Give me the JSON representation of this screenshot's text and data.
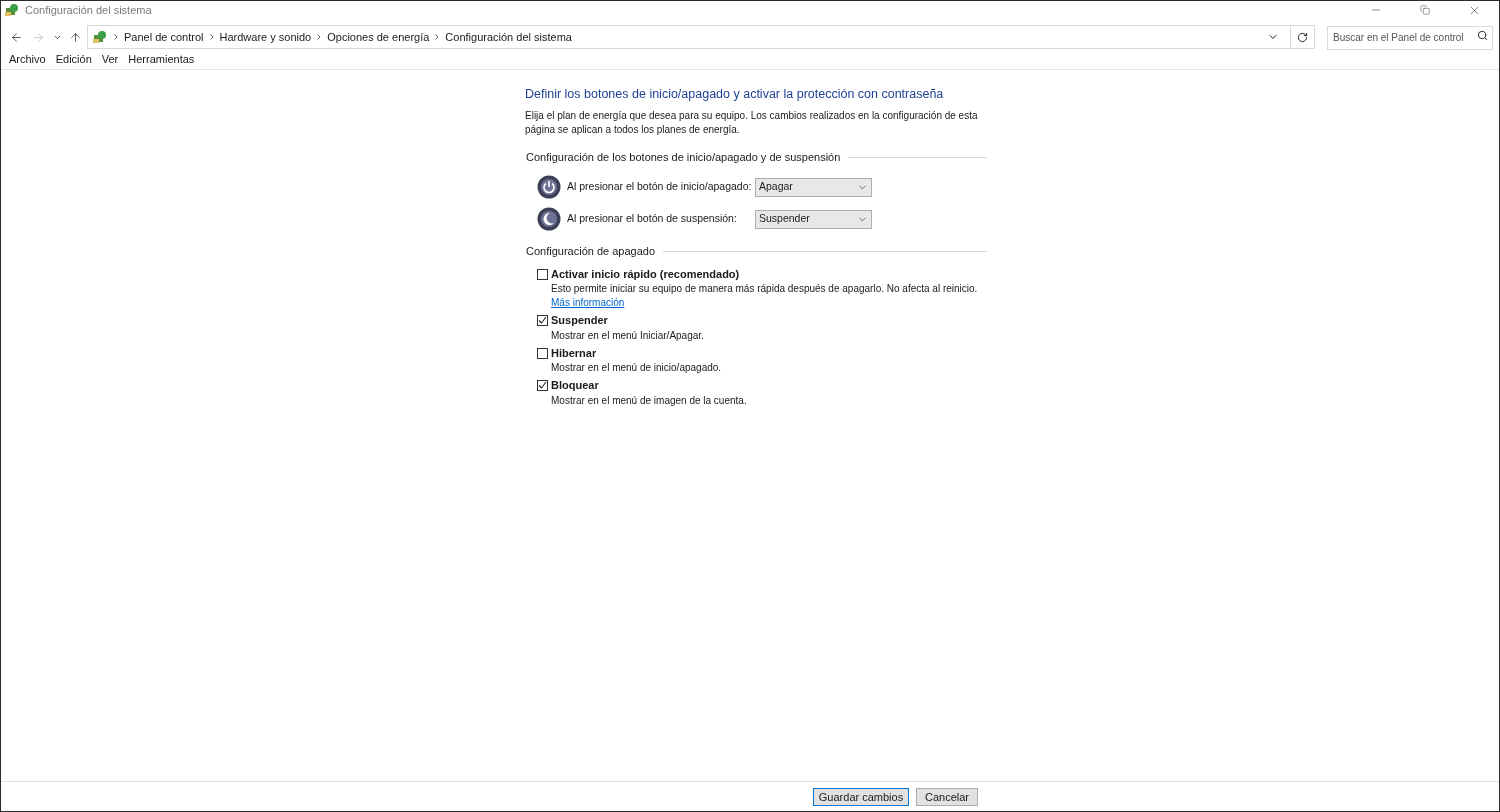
{
  "window": {
    "title": "Configuración del sistema"
  },
  "address_bar": {
    "breadcrumbs": [
      "Panel de control",
      "Hardware y sonido",
      "Opciones de energía",
      "Configuración del sistema"
    ]
  },
  "search": {
    "placeholder": "Buscar en el Panel de control"
  },
  "menu": [
    "Archivo",
    "Edición",
    "Ver",
    "Herramientas"
  ],
  "page": {
    "heading": "Definir los botones de inicio/apagado y activar la protección con contraseña",
    "intro": "Elija el plan de energía que desea para su equipo. Los cambios realizados en la configuración de esta página se aplican a todos los planes de energía.",
    "button_section": {
      "title": "Configuración de los botones de inicio/apagado y de suspensión",
      "rows": [
        {
          "kind": "power",
          "label": "Al presionar el botón de inicio/apagado:",
          "value": "Apagar"
        },
        {
          "kind": "sleep",
          "label": "Al presionar el botón de suspensión:",
          "value": "Suspender"
        }
      ]
    },
    "shutdown_section": {
      "title": "Configuración de apagado",
      "options": [
        {
          "label": "Activar inicio rápido (recomendado)",
          "checked": false,
          "description": "Esto permite iniciar su equipo de manera más rápida después de apagarlo. No afecta al reinicio.",
          "link": "Más información"
        },
        {
          "label": "Suspender",
          "checked": true,
          "description": "Mostrar en el menú Iniciar/Apagar."
        },
        {
          "label": "Hibernar",
          "checked": false,
          "description": "Mostrar en el menú de inicio/apagado."
        },
        {
          "label": "Bloquear",
          "checked": true,
          "description": "Mostrar en el menú de imagen de la cuenta."
        }
      ]
    }
  },
  "footer": {
    "buttons": [
      "Guardar cambios",
      "Cancelar"
    ]
  }
}
